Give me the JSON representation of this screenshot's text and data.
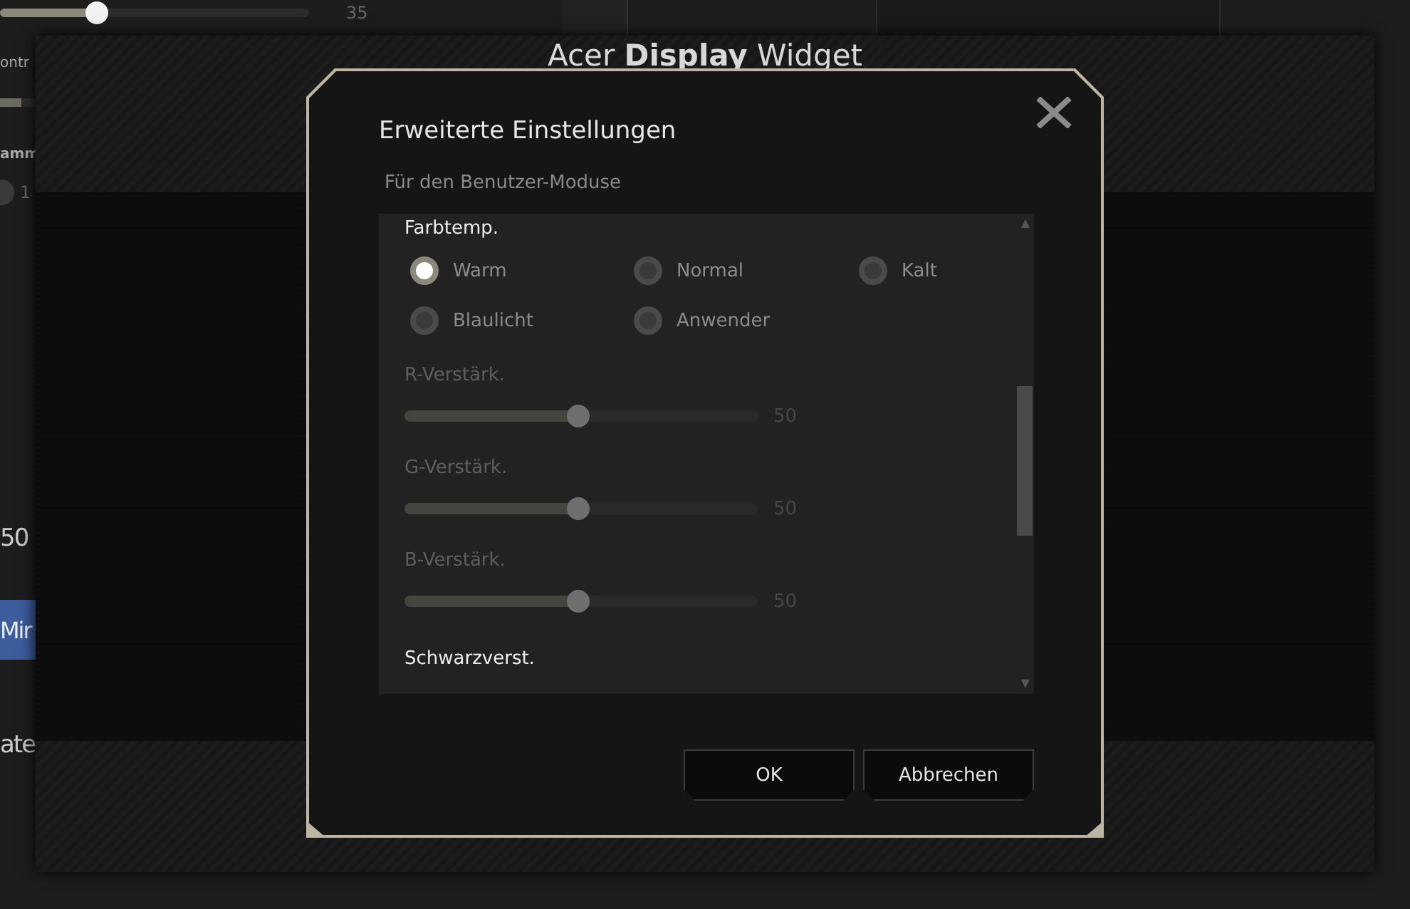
{
  "background_app": {
    "top_slider": {
      "level": 0.3,
      "reading": "35"
    },
    "labels": [
      "ontr",
      "amm"
    ],
    "second_slider": {
      "level": 0.6
    },
    "radio": {
      "label": "1",
      "selected": false
    },
    "rows": [
      {
        "kind": "text",
        "text": "50"
      },
      {
        "kind": "button",
        "text": "Mir"
      },
      {
        "kind": "text",
        "text": "ate"
      }
    ]
  },
  "widget_window": {
    "title": "Acer **Display** Widget"
  },
  "dialog": {
    "title": "Erweiterte Einstellungen",
    "subtitle": "Für den Benutzer-Moduse",
    "sections": [
      {
        "kind": "radios",
        "title": "Farbtemp.",
        "options": [
          {
            "label": "Warm",
            "selected": true
          },
          {
            "label": "Normal",
            "selected": false
          },
          {
            "label": "Kalt",
            "selected": false
          },
          {
            "label": "Blaulicht",
            "selected": false
          },
          {
            "label": "Anwender",
            "selected": false
          }
        ]
      },
      {
        "kind": "slider",
        "title": "R-Verstärk.",
        "level": 0.49,
        "reading": "50",
        "disabled": true
      },
      {
        "kind": "slider",
        "title": "G-Verstärk.",
        "level": 0.49,
        "reading": "50",
        "disabled": true
      },
      {
        "kind": "slider",
        "title": "B-Verstärk.",
        "level": 0.49,
        "reading": "50",
        "disabled": true
      },
      {
        "kind": "heading",
        "title": "Schwarzverst."
      }
    ],
    "scroll_up": "▲",
    "scroll_down": "▼",
    "buttons": [
      "OK",
      "Abbrechen"
    ]
  }
}
